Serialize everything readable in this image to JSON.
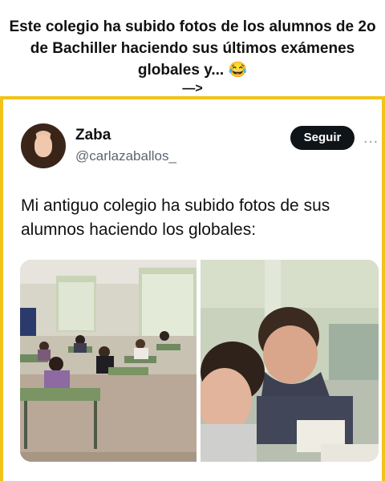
{
  "caption": {
    "lines": [
      "Este colegio ha subido fotos de los alumnos de 2o",
      "de Bachiller haciendo sus últimos exámenes",
      "globales y... 😂"
    ],
    "arrow": "—>"
  },
  "tweet": {
    "author_name": "Zaba",
    "author_handle": "@carlazaballos_",
    "follow_label": "Seguir",
    "more_icon": "…",
    "text": "Mi antiguo colegio ha subido fotos de sus alumnos haciendo los globales:"
  },
  "colors": {
    "card_border": "#f2c31b",
    "follow_bg": "#0f1419",
    "handle": "#5b6670"
  }
}
